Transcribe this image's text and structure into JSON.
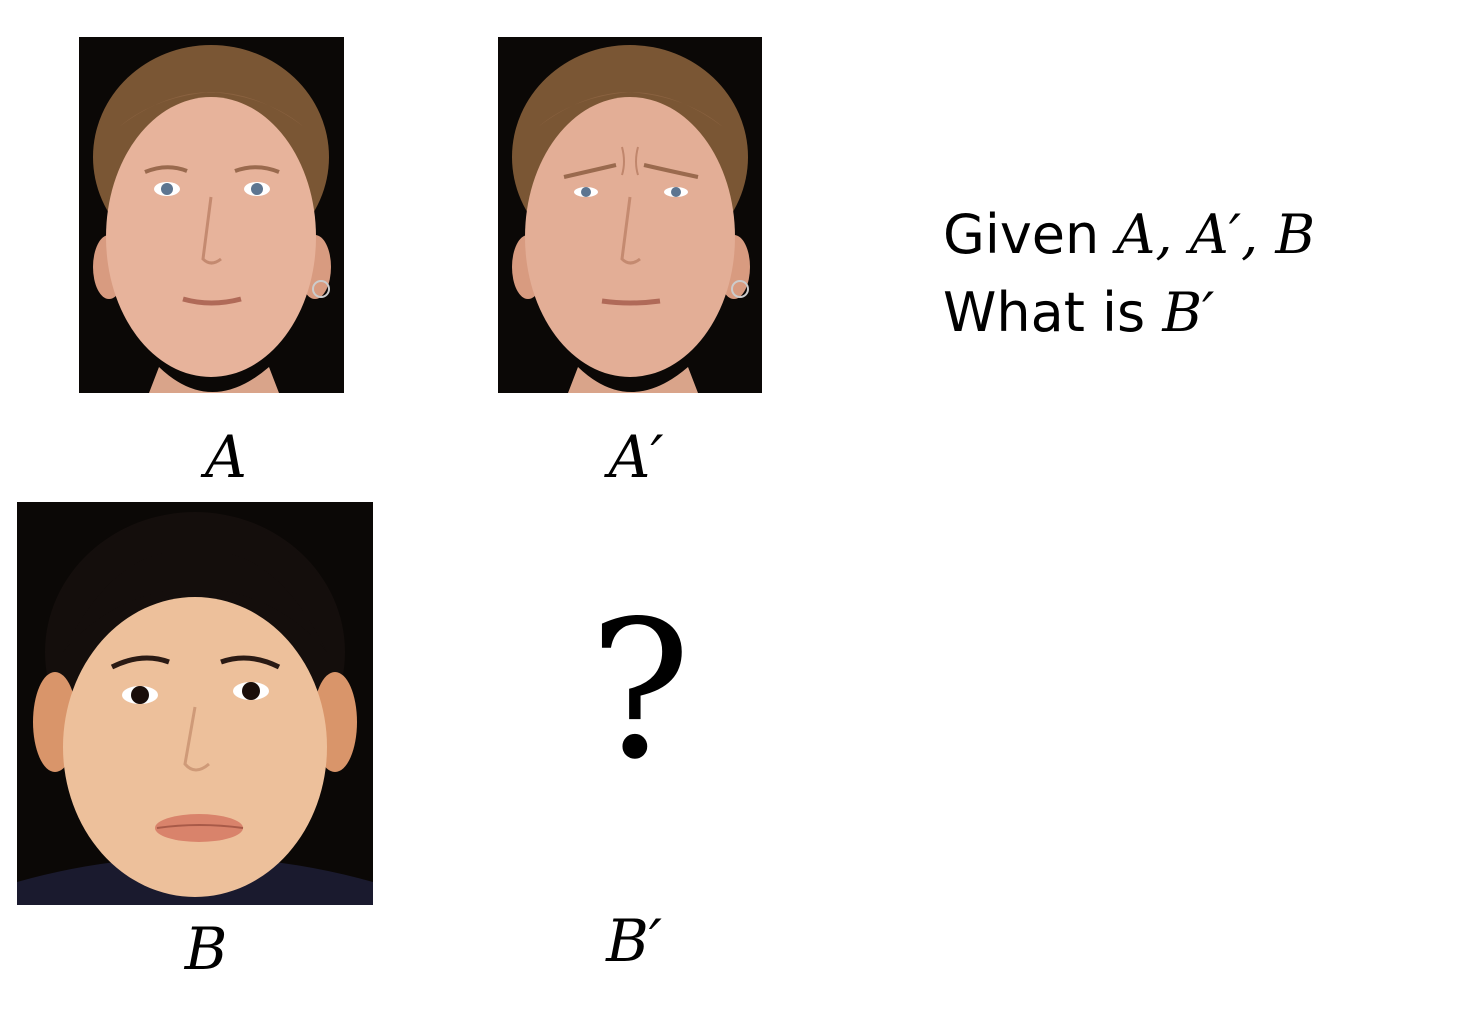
{
  "labels": {
    "a": "A",
    "a_prime": "A′",
    "b": "B",
    "b_prime": "B′"
  },
  "unknown_symbol": "?",
  "prompt": {
    "line1_text": "Given ",
    "line1_math": "A, A′, B",
    "line2_text": "What is ",
    "line2_math": "B′"
  },
  "photos": {
    "a": "face-neutral",
    "a_prime": "face-frowning",
    "b": "face-neutral"
  },
  "colors": {
    "background": "#0b0806",
    "skin_a": "#e7b39b",
    "skin_b": "#edc09b",
    "hair_a": "#7a5634",
    "hair_b": "#140e0c"
  }
}
